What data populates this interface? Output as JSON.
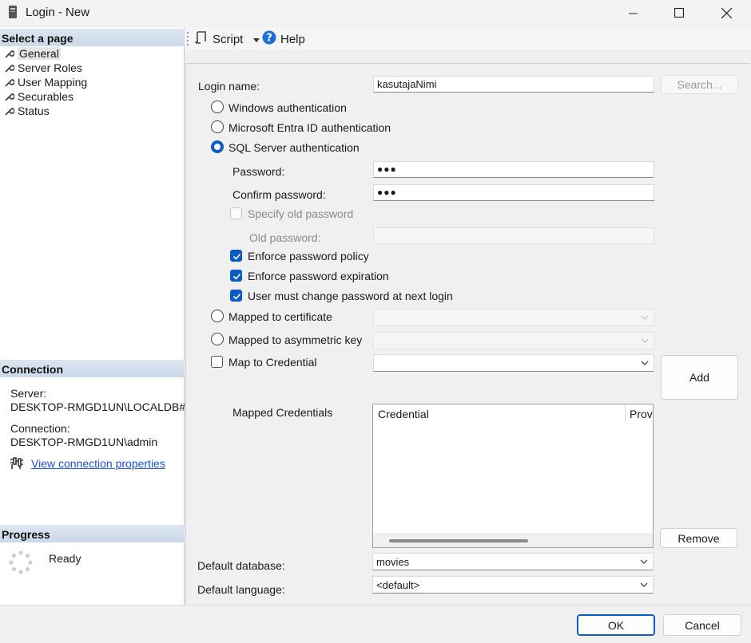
{
  "window": {
    "title": "Login - New"
  },
  "left": {
    "select_page_header": "Select a page",
    "pages": [
      {
        "label": "General",
        "selected": true
      },
      {
        "label": "Server Roles",
        "selected": false
      },
      {
        "label": "User Mapping",
        "selected": false
      },
      {
        "label": "Securables",
        "selected": false
      },
      {
        "label": "Status",
        "selected": false
      }
    ],
    "connection_header": "Connection",
    "server_label": "Server:",
    "server_value": "DESKTOP-RMGD1UN\\LOCALDB#",
    "connection_label": "Connection:",
    "connection_value": "DESKTOP-RMGD1UN\\admin",
    "view_props_link": "View connection properties",
    "progress_header": "Progress",
    "progress_status": "Ready"
  },
  "toolbar": {
    "script_label": "Script",
    "help_label": "Help"
  },
  "general": {
    "login_name_label": "Login name:",
    "login_name_value": "kasutajaNimi",
    "search_button": "Search...",
    "auth_options": [
      {
        "label": "Windows authentication",
        "selected": false
      },
      {
        "label": "Microsoft Entra ID authentication",
        "selected": false
      },
      {
        "label": "SQL Server authentication",
        "selected": true
      }
    ],
    "password_label": "Password:",
    "password_value": "●●●",
    "confirm_password_label": "Confirm password:",
    "confirm_password_value": "●●●",
    "specify_old_password_label": "Specify old password",
    "old_password_label": "Old password:",
    "enforce_policy_label": "Enforce password policy",
    "enforce_expiration_label": "Enforce password expiration",
    "must_change_label": "User must change password at next login",
    "mapped_certificate_label": "Mapped to certificate",
    "mapped_asym_key_label": "Mapped to asymmetric key",
    "map_credential_label": "Map to Credential",
    "add_button": "Add",
    "mapped_credentials_label": "Mapped Credentials",
    "cred_columns": [
      "Credential",
      "Prov"
    ],
    "remove_button": "Remove",
    "default_database_label": "Default database:",
    "default_database_value": "movies",
    "default_language_label": "Default language:",
    "default_language_value": "<default>"
  },
  "footer": {
    "ok_button": "OK",
    "cancel_button": "Cancel"
  },
  "colors": {
    "accent": "#0a5cc2",
    "link": "#1a4fd6",
    "section_header": "#cbd8e8"
  }
}
